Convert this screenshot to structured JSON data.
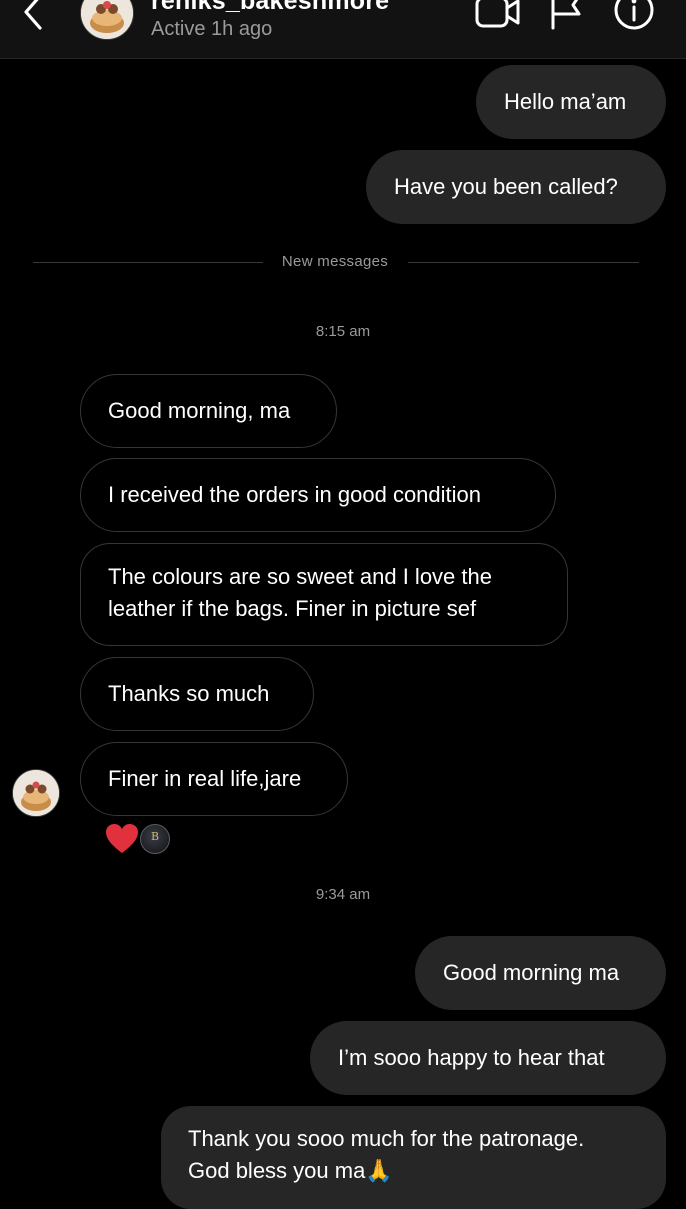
{
  "header": {
    "username": "reniks_bakeshmore",
    "status": "Active 1h ago",
    "icons": [
      "back-chevron-icon",
      "video-call-icon",
      "flag-icon",
      "info-icon"
    ]
  },
  "messages_before": [
    {
      "text": "Hello ma’am"
    },
    {
      "text": "Have you been called?"
    }
  ],
  "separator": "New messages",
  "time_1": "8:15 am",
  "received": [
    {
      "text": "Good morning, ma"
    },
    {
      "text": "I received the orders in good condition"
    },
    {
      "line1": "The colours are so sweet and I love the",
      "line2": "leather if the bags. Finer in picture sef"
    },
    {
      "text": "Thanks so much"
    },
    {
      "text": "Finer in real life,jare"
    }
  ],
  "reactions": {
    "emoji": "heart",
    "reactor_initial": "B"
  },
  "time_2": "9:34 am",
  "sent_after": [
    {
      "text": "Good morning ma"
    },
    {
      "text": "I’m sooo happy to hear that"
    },
    {
      "line1": "Thank you sooo much for the patronage.",
      "line2": "God bless you ma",
      "emoji": "🙏"
    }
  ],
  "colors": {
    "background": "#000000",
    "sent_bubble": "#262626",
    "received_border": "#363636",
    "secondary_text": "#9a9a9a",
    "heart": "#e0313d"
  }
}
